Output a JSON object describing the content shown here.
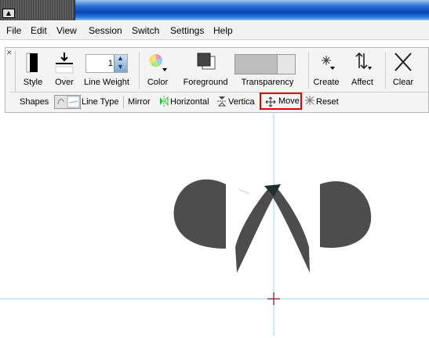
{
  "menu": [
    "File",
    "Edit",
    "View",
    "Session",
    "Switch",
    "Settings",
    "Help"
  ],
  "toolbar": {
    "style_label": "Style",
    "over_label": "Over",
    "line_weight_label": "Line Weight",
    "line_weight_value": "1",
    "color_label": "Color",
    "foreground_label": "Foreground",
    "transparency_label": "Transparency",
    "create_label": "Create",
    "affect_label": "Affect",
    "clear_label": "Clear"
  },
  "toolbar2": {
    "shapes_label": "Shapes",
    "line_type_label": "Line Type",
    "mirror_label": "Mirror",
    "horizontal_label": "Horizontal",
    "vertical_label": "Vertica",
    "move_label": "Move",
    "reset_label": "Reset"
  },
  "colors": {
    "highlight": "#e00000",
    "guide": "#8fd8e8",
    "shape": "#4d4d4d"
  }
}
